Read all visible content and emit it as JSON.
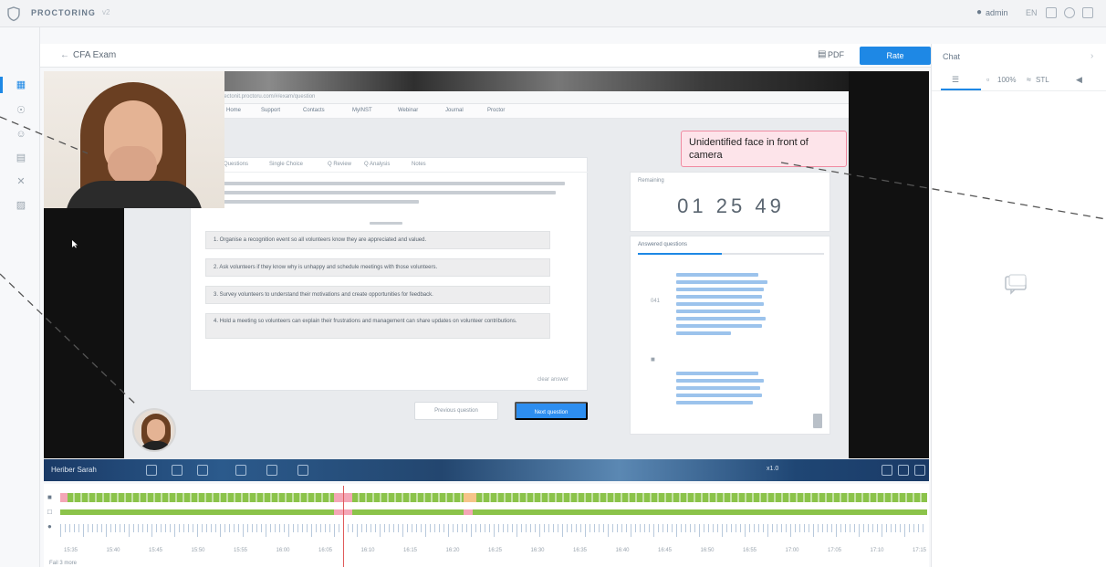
{
  "app": {
    "name": "PROCTORING",
    "version": "v2"
  },
  "topbar": {
    "user_name": "admin",
    "lang": "EN"
  },
  "header": {
    "title": "CFA Exam",
    "pdf_label": "PDF",
    "rate_label": "Rate"
  },
  "right_panel": {
    "title": "Chat",
    "tools": [
      "100%",
      "STL"
    ]
  },
  "browser": {
    "url": "lectonit.proctoru.com/#/exam/question",
    "bookmarks": [
      "Home",
      "Support",
      "Contacts",
      "MyINST",
      "Webinar",
      "Journal",
      "Proctor"
    ]
  },
  "exam": {
    "tabs": [
      "Questions",
      "Single Choice",
      "Q Review",
      "Q Analysis",
      "Notes"
    ],
    "answers": [
      "1.  Organise a recognition event so all volunteers know they are appreciated and valued.",
      "2.  Ask volunteers if they know why is unhappy and schedule meetings with those volunteers.",
      "3.  Survey volunteers to understand their motivations and create opportunities for feedback.",
      "4.  Hold a meeting so volunteers can explain their frustrations and management can share updates on volunteer contributions."
    ],
    "clear_link": "clear answer",
    "prev_label": "Previous question",
    "next_label": "Next question"
  },
  "timer": {
    "label": "Remaining",
    "value": "01  25  49"
  },
  "questions_panel": {
    "title": "Answered questions",
    "progress": 0.45,
    "items": [
      {
        "num": "041"
      },
      {
        "num": ""
      }
    ]
  },
  "alert": {
    "text": "Unidentified face in front of camera"
  },
  "bottom_bar": {
    "user": "Heriber Sarah",
    "speed": "x1.0"
  },
  "timeline": {
    "time_labels": [
      "15:35",
      "15:40",
      "15:45",
      "15:50",
      "15:55",
      "16:00",
      "16:05",
      "16:10",
      "16:15",
      "16:20",
      "16:25",
      "16:30",
      "16:35",
      "16:40",
      "16:45",
      "16:50",
      "16:55",
      "17:00",
      "17:05",
      "17:10",
      "17:15"
    ],
    "footer": "Fail 3 more"
  }
}
